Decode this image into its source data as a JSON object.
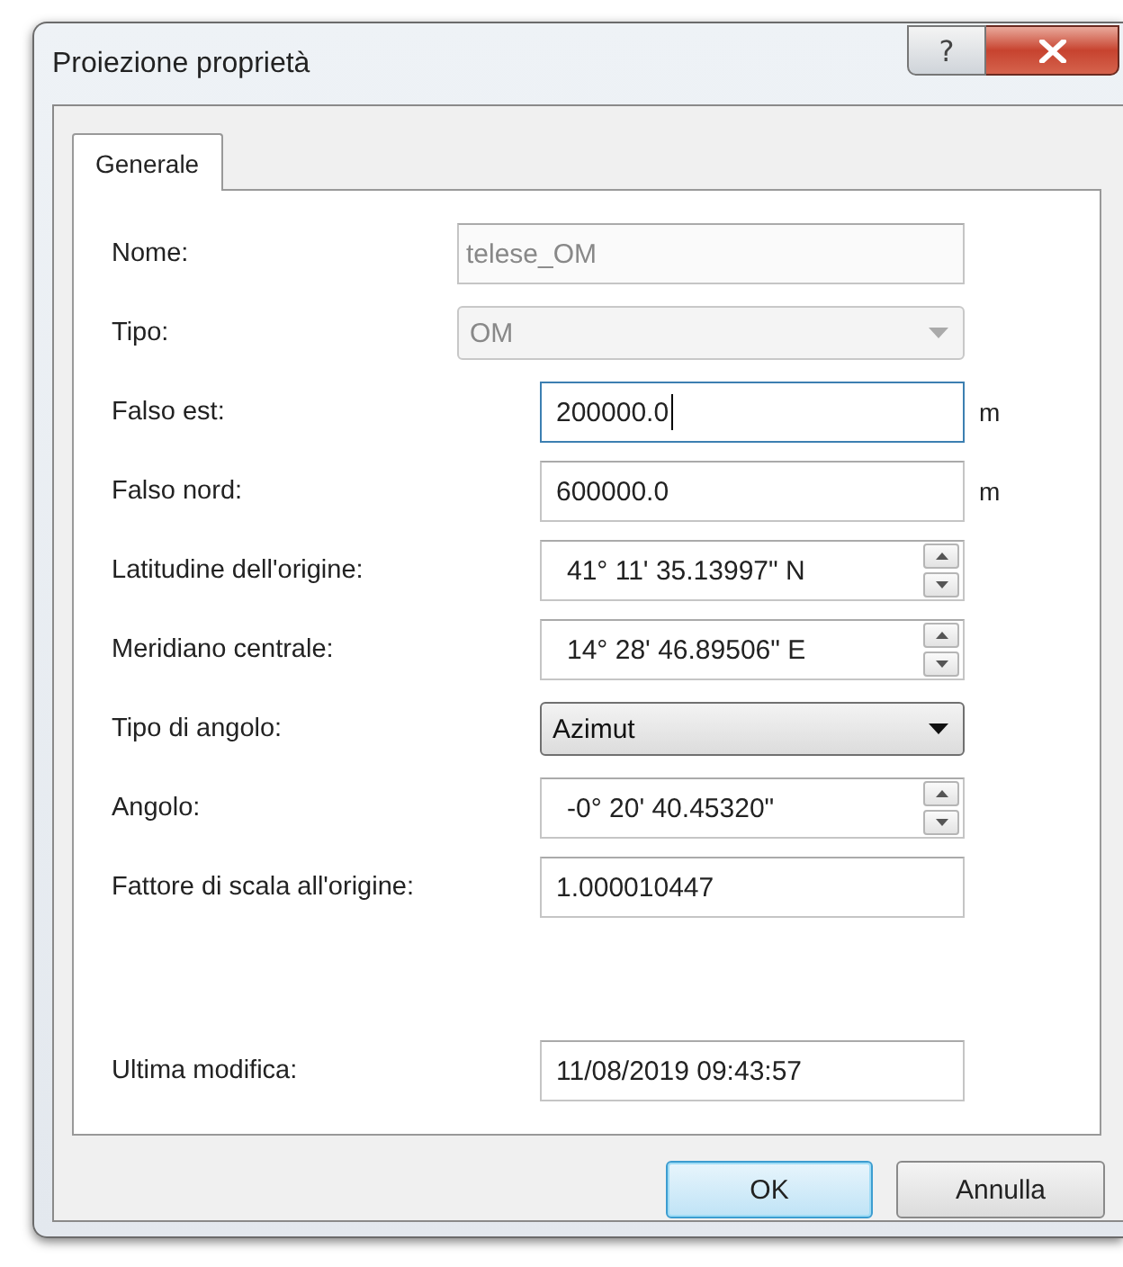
{
  "window": {
    "title": "Proiezione proprietà",
    "help_button": "?"
  },
  "tabs": [
    {
      "label": "Generale",
      "selected": true
    }
  ],
  "fields": [
    {
      "label": "Nome:",
      "kind": "text",
      "value": "telese_OM",
      "disabled": true
    },
    {
      "label": "Tipo:",
      "kind": "combo",
      "value": "OM",
      "disabled": true
    },
    {
      "label": "Falso est:",
      "kind": "text",
      "value": "200000.0",
      "unit": "m",
      "focused": true
    },
    {
      "label": "Falso nord:",
      "kind": "text",
      "value": "600000.0",
      "unit": "m"
    },
    {
      "label": "Latitudine dell'origine:",
      "kind": "spin",
      "value": "41° 11' 35.13997\" N"
    },
    {
      "label": "Meridiano centrale:",
      "kind": "spin",
      "value": "14° 28' 46.89506\" E"
    },
    {
      "label": "Tipo di angolo:",
      "kind": "combo",
      "value": "Azimut"
    },
    {
      "label": "Angolo:",
      "kind": "spin",
      "value": "-0° 20' 40.45320\""
    },
    {
      "label": "Fattore di scala all'origine:",
      "kind": "text",
      "value": "1.000010447"
    }
  ],
  "footer_field": {
    "label": "Ultima modifica:",
    "kind": "text",
    "value": "11/08/2019 09:43:57"
  },
  "buttons": [
    {
      "label": "OK",
      "default": true
    },
    {
      "label": "Annulla",
      "default": false
    }
  ]
}
